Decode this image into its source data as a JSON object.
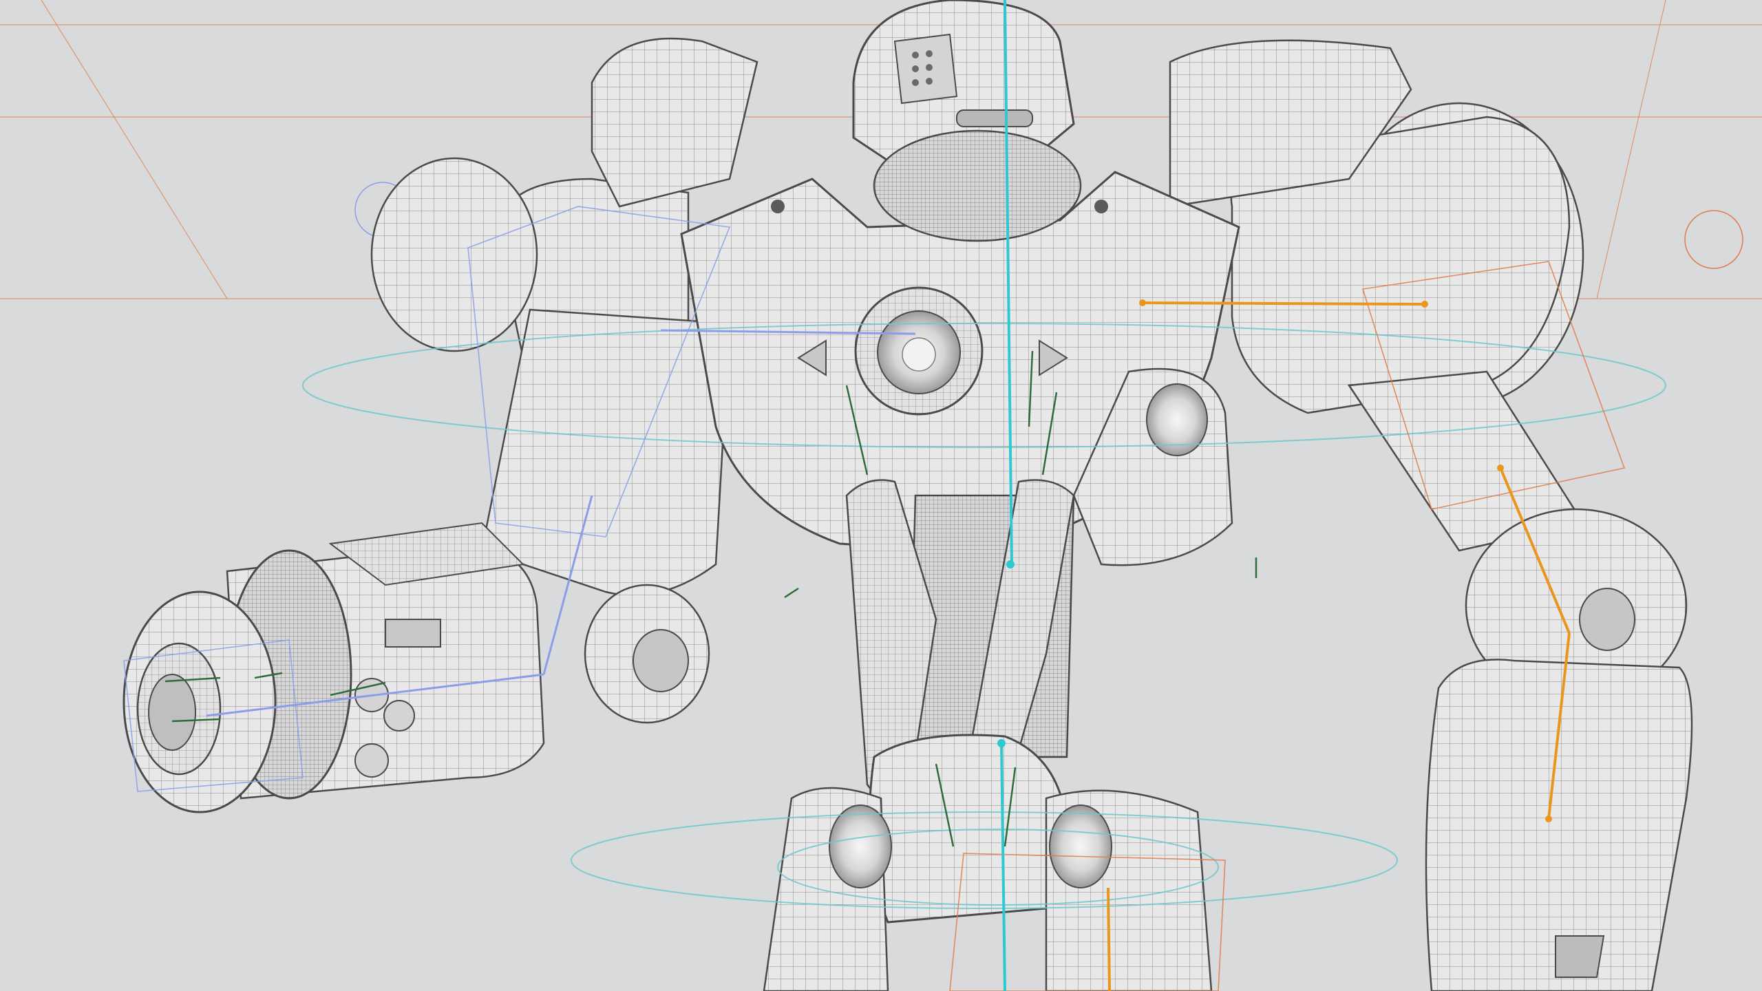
{
  "viewport": {
    "background": "#d9dadb",
    "subject": "wireframe-robot-rig"
  },
  "colors": {
    "mesh_fill": "#e6e6e6",
    "mesh_fill_dark": "#c9c9c9",
    "wire": "#7a7a7a",
    "wire_light": "#a6a6a6",
    "outline": "#4a4a4a",
    "spine_bone": "#2ec8d0",
    "cyan_control": "#6fc7cc",
    "orange_bone": "#e9961e",
    "orange_guide": "#e07a4a",
    "blue_control": "#8a9ee8",
    "green_bone": "#2f6b3a"
  },
  "icons": {
    "chest_arrows": [
      "triangle-left-icon",
      "triangle-right-icon"
    ],
    "control_circles": [
      "circle-control-icon"
    ]
  }
}
